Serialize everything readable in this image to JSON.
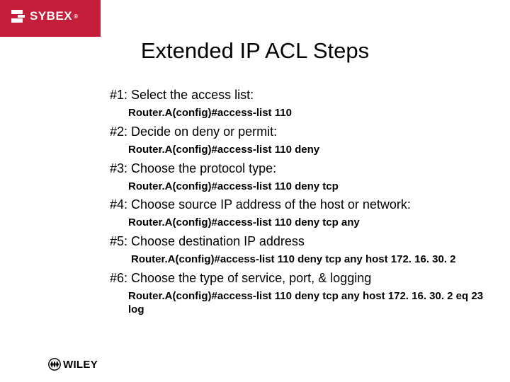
{
  "brand": {
    "sybex": "SYBEX",
    "wiley": "WILEY"
  },
  "title": "Extended IP ACL Steps",
  "steps": [
    {
      "heading": "#1: Select the access list:",
      "cmd": "Router.A(config)#access-list 110"
    },
    {
      "heading": "#2: Decide on deny or permit:",
      "cmd": "Router.A(config)#access-list 110 deny"
    },
    {
      "heading": "#3: Choose the protocol type:",
      "cmd": "Router.A(config)#access-list 110 deny tcp"
    },
    {
      "heading": "#4: Choose source IP address of the host or network:",
      "cmd": "Router.A(config)#access-list 110 deny tcp any"
    },
    {
      "heading": "#5: Choose destination IP address",
      "cmd": "Router.A(config)#access-list 110 deny tcp any host 172. 16. 30. 2"
    },
    {
      "heading": "#6: Choose the type of service, port, & logging",
      "cmd": "Router.A(config)#access-list 110 deny tcp any host 172. 16. 30. 2 eq 23 log"
    }
  ]
}
